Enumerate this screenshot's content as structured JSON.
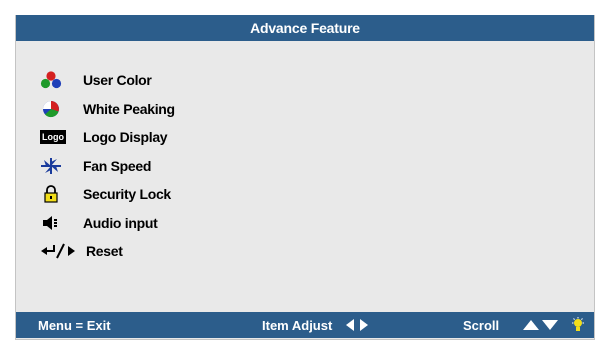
{
  "header": {
    "title": "Advance Feature"
  },
  "menu": {
    "items": [
      {
        "label": "User Color",
        "icon": "user-color-icon"
      },
      {
        "label": "White Peaking",
        "icon": "white-peaking-icon"
      },
      {
        "label": "Logo Display",
        "icon": "logo-display-icon",
        "icon_text": "Logo"
      },
      {
        "label": "Fan Speed",
        "icon": "fan-speed-icon"
      },
      {
        "label": "Security Lock",
        "icon": "security-lock-icon"
      },
      {
        "label": "Audio input",
        "icon": "audio-input-icon"
      },
      {
        "label": "Reset",
        "icon": "reset-icon"
      }
    ]
  },
  "footer": {
    "menu_exit": "Menu = Exit",
    "item_adjust": "Item Adjust",
    "scroll": "Scroll"
  },
  "colors": {
    "bar": "#2c5d8b",
    "panel": "#e9e9e9",
    "lock": "#f2de1a"
  }
}
